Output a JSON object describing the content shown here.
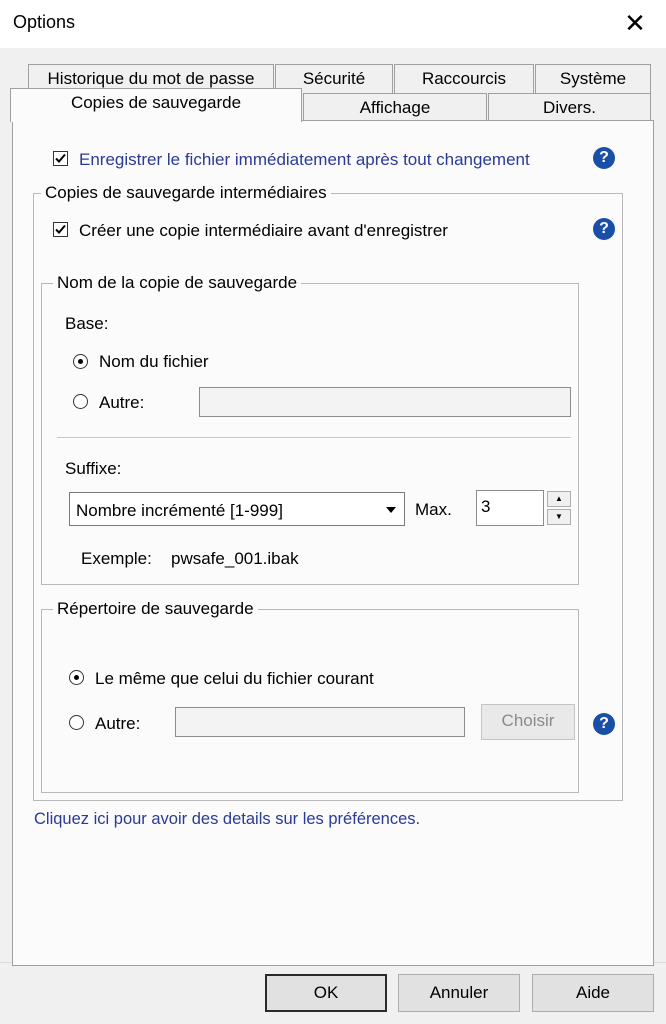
{
  "window": {
    "title": "Options"
  },
  "tabs": {
    "row1": [
      "Historique du mot de passe",
      "Sécurité",
      "Raccourcis",
      "Système"
    ],
    "row2": [
      "Copies de sauvegarde",
      "Affichage",
      "Divers."
    ],
    "active": "Copies de sauvegarde"
  },
  "panel": {
    "save_immediately": {
      "label": "Enregistrer le fichier immédiatement après tout changement",
      "checked": true
    },
    "intermediate_group": {
      "legend": "Copies de sauvegarde intermédiaires",
      "create_copy": {
        "label": "Créer une copie intermédiaire avant d'enregistrer",
        "checked": true
      }
    },
    "backup_name_group": {
      "legend": "Nom de la copie de sauvegarde",
      "base_label": "Base:",
      "option_filename": "Nom du fichier",
      "option_other": "Autre:",
      "selected": "Nom du fichier",
      "other_value": "",
      "suffix_label": "Suffixe:",
      "suffix_value": "Nombre incrémenté [1-999]",
      "max_label": "Max.",
      "max_value": "3",
      "example_label": "Exemple:",
      "example_value": "pwsafe_001.ibak"
    },
    "backup_dir_group": {
      "legend": "Répertoire de sauvegarde",
      "option_same": "Le même que celui du fichier courant",
      "option_other": "Autre:",
      "selected": "Le même que celui du fichier courant",
      "other_value": "",
      "choose_button": "Choisir"
    },
    "help_link": "Cliquez ici pour avoir des details sur les préférences."
  },
  "buttons": {
    "ok": "OK",
    "cancel": "Annuler",
    "help": "Aide"
  },
  "colors": {
    "help_icon": "#1a4fa8",
    "link": "#2a3a96",
    "panel_bg": "#fbfbfb",
    "window_bg": "#f0f0f0"
  }
}
